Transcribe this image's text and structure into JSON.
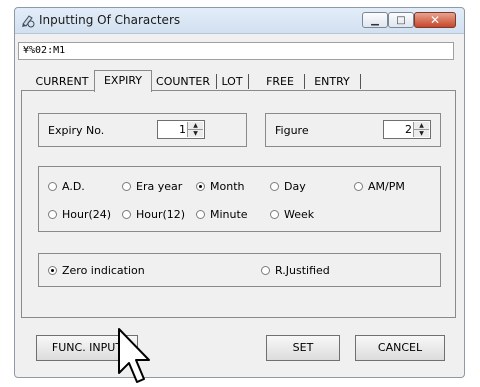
{
  "window": {
    "title": "Inputting Of Characters"
  },
  "path_field": {
    "value": "¥%02:M1"
  },
  "tabs": [
    {
      "label": "CURRENT"
    },
    {
      "label": "EXPIRY"
    },
    {
      "label": "COUNTER"
    },
    {
      "label": "LOT"
    },
    {
      "label": "FREE"
    },
    {
      "label": "ENTRY"
    }
  ],
  "expiry": {
    "no_label": "Expiry No.",
    "no_value": "1",
    "figure_label": "Figure",
    "figure_value": "2"
  },
  "units": [
    {
      "label": "A.D.",
      "checked": false
    },
    {
      "label": "Era year",
      "checked": false
    },
    {
      "label": "Month",
      "checked": true
    },
    {
      "label": "Day",
      "checked": false
    },
    {
      "label": "AM/PM",
      "checked": false
    },
    {
      "label": "Hour(24)",
      "checked": false
    },
    {
      "label": "Hour(12)",
      "checked": false
    },
    {
      "label": "Minute",
      "checked": false
    },
    {
      "label": "Week",
      "checked": false
    }
  ],
  "justify": [
    {
      "label": "Zero indication",
      "checked": true
    },
    {
      "label": "R.Justified",
      "checked": false
    }
  ],
  "buttons": {
    "func_input": "FUNC. INPUT",
    "set": "SET",
    "cancel": "CANCEL"
  }
}
